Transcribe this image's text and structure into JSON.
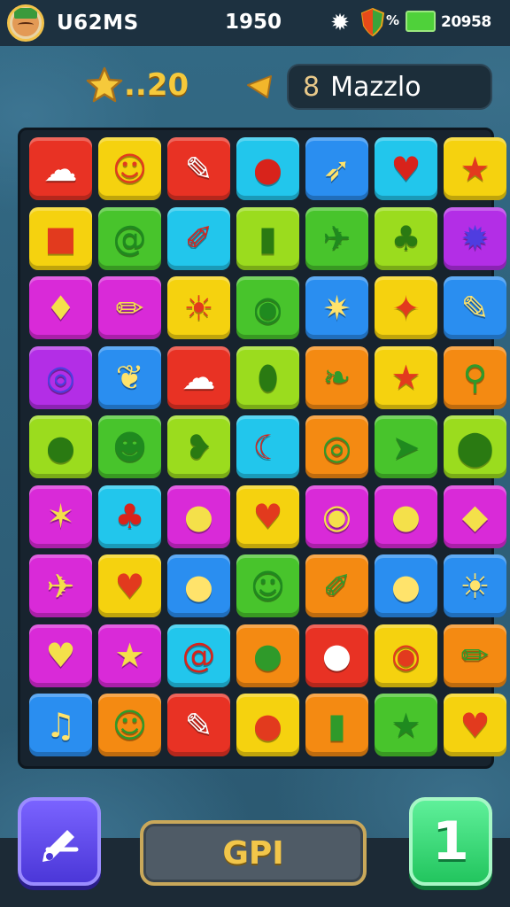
{
  "status_bar": {
    "player_name": "U62MS",
    "score": "1950",
    "percent": "%",
    "battery_value": "20958"
  },
  "hud": {
    "stars": "..20",
    "mode_number": "8",
    "mode_label": "Mazzlo"
  },
  "board": {
    "rows": [
      [
        {
          "color": "red",
          "icon": "cloud-icon",
          "glyph": "☁"
        },
        {
          "color": "yellow",
          "icon": "smiley-icon",
          "glyph": "☺"
        },
        {
          "color": "red",
          "icon": "pen-icon",
          "glyph": "✎"
        },
        {
          "color": "cyan",
          "icon": "apple-icon",
          "glyph": "●"
        },
        {
          "color": "blue",
          "icon": "feather-icon",
          "glyph": "➶"
        },
        {
          "color": "cyan",
          "icon": "apple-icon",
          "glyph": "♥"
        },
        {
          "color": "yellow",
          "icon": "star-icon",
          "glyph": "★"
        }
      ],
      [
        {
          "color": "yellow",
          "icon": "box-icon",
          "glyph": "■"
        },
        {
          "color": "green",
          "icon": "swirl-icon",
          "glyph": "@"
        },
        {
          "color": "cyan",
          "icon": "brush-icon",
          "glyph": "✐"
        },
        {
          "color": "lime",
          "icon": "jar-icon",
          "glyph": "▮"
        },
        {
          "color": "green",
          "icon": "bottle-icon",
          "glyph": "✈"
        },
        {
          "color": "lime",
          "icon": "blob-icon",
          "glyph": "♣"
        },
        {
          "color": "purple",
          "icon": "gear-icon",
          "glyph": "✹"
        }
      ],
      [
        {
          "color": "magenta",
          "icon": "beet-icon",
          "glyph": "♦"
        },
        {
          "color": "magenta",
          "icon": "crayon-icon",
          "glyph": "✏"
        },
        {
          "color": "yellow",
          "icon": "sun-icon",
          "glyph": "☀"
        },
        {
          "color": "green",
          "icon": "moon-face-icon",
          "glyph": "◉"
        },
        {
          "color": "blue",
          "icon": "spiky-ball-icon",
          "glyph": "✷"
        },
        {
          "color": "yellow",
          "icon": "plane-icon",
          "glyph": "✦"
        },
        {
          "color": "blue",
          "icon": "pencil-icon",
          "glyph": "✎"
        }
      ],
      [
        {
          "color": "purple",
          "icon": "spiral-icon",
          "glyph": "◎"
        },
        {
          "color": "blue",
          "icon": "leaf-icon",
          "glyph": "❦"
        },
        {
          "color": "red",
          "icon": "cloud-icon",
          "glyph": "☁"
        },
        {
          "color": "lime",
          "icon": "seed-icon",
          "glyph": "⬮"
        },
        {
          "color": "orange",
          "icon": "leaf-icon",
          "glyph": "❧"
        },
        {
          "color": "yellow",
          "icon": "star-pin-icon",
          "glyph": "★"
        },
        {
          "color": "orange",
          "icon": "wand-icon",
          "glyph": "⚲"
        }
      ],
      [
        {
          "color": "lime",
          "icon": "peanut-icon",
          "glyph": "●"
        },
        {
          "color": "green",
          "icon": "slime-icon",
          "glyph": "☻"
        },
        {
          "color": "lime",
          "icon": "bean-icon",
          "glyph": "❥"
        },
        {
          "color": "cyan",
          "icon": "banana-icon",
          "glyph": "☾"
        },
        {
          "color": "orange",
          "icon": "ring-icon",
          "glyph": "◎"
        },
        {
          "color": "green",
          "icon": "arrow-icon",
          "glyph": "➤"
        },
        {
          "color": "lime",
          "icon": "pin-icon",
          "glyph": "⬤"
        }
      ],
      [
        {
          "color": "magenta",
          "icon": "critter-icon",
          "glyph": "✶"
        },
        {
          "color": "cyan",
          "icon": "grapes-icon",
          "glyph": "♣"
        },
        {
          "color": "magenta",
          "icon": "orange-icon",
          "glyph": "●"
        },
        {
          "color": "yellow",
          "icon": "strawberry-icon",
          "glyph": "♥"
        },
        {
          "color": "magenta",
          "icon": "donut-icon",
          "glyph": "◉"
        },
        {
          "color": "magenta",
          "icon": "balloon-icon",
          "glyph": "●"
        },
        {
          "color": "magenta",
          "icon": "leaf-icon",
          "glyph": "◆"
        }
      ],
      [
        {
          "color": "magenta",
          "icon": "rocket-icon",
          "glyph": "✈"
        },
        {
          "color": "yellow",
          "icon": "heart-icon",
          "glyph": "♥"
        },
        {
          "color": "blue",
          "icon": "cherry-icon",
          "glyph": "●"
        },
        {
          "color": "green",
          "icon": "smiley-icon",
          "glyph": "☺"
        },
        {
          "color": "orange",
          "icon": "rocket-icon",
          "glyph": "✐"
        },
        {
          "color": "blue",
          "icon": "balloon-icon",
          "glyph": "●"
        },
        {
          "color": "blue",
          "icon": "sun-icon",
          "glyph": "☀"
        }
      ],
      [
        {
          "color": "magenta",
          "icon": "heart-icon",
          "glyph": "♥"
        },
        {
          "color": "magenta",
          "icon": "star-icon",
          "glyph": "★"
        },
        {
          "color": "cyan",
          "icon": "swirl-icon",
          "glyph": "@"
        },
        {
          "color": "orange",
          "icon": "berry-icon",
          "glyph": "●"
        },
        {
          "color": "red",
          "icon": "bubble-icon",
          "glyph": "●"
        },
        {
          "color": "yellow",
          "icon": "eye-icon",
          "glyph": "◉"
        },
        {
          "color": "orange",
          "icon": "marker-icon",
          "glyph": "✏"
        }
      ],
      [
        {
          "color": "blue",
          "icon": "lollipop-icon",
          "glyph": "♫"
        },
        {
          "color": "orange",
          "icon": "smiley-icon",
          "glyph": "☺"
        },
        {
          "color": "red",
          "icon": "feather-icon",
          "glyph": "✎"
        },
        {
          "color": "yellow",
          "icon": "bubble-icon",
          "glyph": "●"
        },
        {
          "color": "orange",
          "icon": "bottle-icon",
          "glyph": "▮"
        },
        {
          "color": "green",
          "icon": "star-icon",
          "glyph": "★"
        },
        {
          "color": "yellow",
          "icon": "apple-icon",
          "glyph": "♥"
        }
      ]
    ]
  },
  "buttons": {
    "main_label": "GPI",
    "right_label": "1"
  },
  "colors": {
    "red": "#e83224",
    "yellow": "#f5d20f",
    "cyan": "#22c6ec",
    "blue": "#2a8ef0",
    "green": "#48c42c",
    "lime": "#9bdc1e",
    "purple": "#b32ee6",
    "magenta": "#d92ad8",
    "orange": "#f48a12"
  },
  "glyph_colors": {
    "red": "#fff",
    "yellow": "#e23a1e",
    "cyan": "#d8231b",
    "blue": "#ffe36b",
    "green": "#1f8a1f",
    "lime": "#2a7a12",
    "purple": "#4f3de0",
    "magenta": "#f4e04a",
    "orange": "#2f9a2a"
  }
}
